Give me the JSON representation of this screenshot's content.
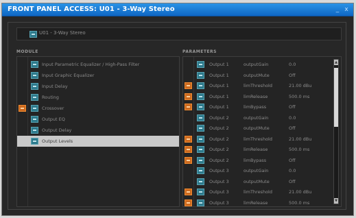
{
  "window": {
    "title": "FRONT PANEL ACCESS: U01 - 3-Way Stereo",
    "minimize_glyph": "_",
    "close_glyph": "x"
  },
  "preset": {
    "label": "U01 - 3-Way Stereo"
  },
  "headers": {
    "modules": "MODULE",
    "parameters": "PARAMETERS"
  },
  "modules": [
    {
      "label": "Input Parametric Equalizer / High-Pass Filter",
      "state": "check"
    },
    {
      "label": "Input Graphic Equalizer",
      "state": "check"
    },
    {
      "label": "Input Delay",
      "state": "check"
    },
    {
      "label": "Routing",
      "state": "check"
    },
    {
      "label": "Crossover",
      "state": "lock"
    },
    {
      "label": "Output EQ",
      "state": "check"
    },
    {
      "label": "Output Delay",
      "state": "check"
    },
    {
      "label": "Output Levels",
      "state": "check",
      "selected": true
    }
  ],
  "parameters": [
    {
      "state": "check",
      "output": "Output 1",
      "param": "outputGain",
      "value": "0.0"
    },
    {
      "state": "check",
      "output": "Output 1",
      "param": "outputMute",
      "value": "Off"
    },
    {
      "state": "lock",
      "output": "Output 1",
      "param": "limThreshold",
      "value": "21.00 dBu"
    },
    {
      "state": "lock",
      "output": "Output 1",
      "param": "limRelease",
      "value": "500.0 ms"
    },
    {
      "state": "lock",
      "output": "Output 1",
      "param": "limBypass",
      "value": "Off"
    },
    {
      "state": "check",
      "output": "Output 2",
      "param": "outputGain",
      "value": "0.0"
    },
    {
      "state": "check",
      "output": "Output 2",
      "param": "outputMute",
      "value": "Off"
    },
    {
      "state": "lock",
      "output": "Output 2",
      "param": "limThreshold",
      "value": "21.00 dBu"
    },
    {
      "state": "lock",
      "output": "Output 2",
      "param": "limRelease",
      "value": "500.0 ms"
    },
    {
      "state": "lock",
      "output": "Output 2",
      "param": "limBypass",
      "value": "Off"
    },
    {
      "state": "check",
      "output": "Output 3",
      "param": "outputGain",
      "value": "0.0"
    },
    {
      "state": "check",
      "output": "Output 3",
      "param": "outputMute",
      "value": "Off"
    },
    {
      "state": "lock",
      "output": "Output 3",
      "param": "limThreshold",
      "value": "21.00 dBu"
    },
    {
      "state": "lock",
      "output": "Output 3",
      "param": "limRelease",
      "value": "500.0 ms"
    }
  ],
  "scrollbar": {
    "up_glyph": "▲",
    "down_glyph": "▼"
  },
  "icons": {
    "check": "enabled-checkbox-icon",
    "lock": "locked-checkbox-icon"
  },
  "colors": {
    "titlebar": "#1a7bd6",
    "check": "#2d7a8c",
    "lock": "#cc6a1f",
    "selected_row": "#c9c9c9"
  }
}
